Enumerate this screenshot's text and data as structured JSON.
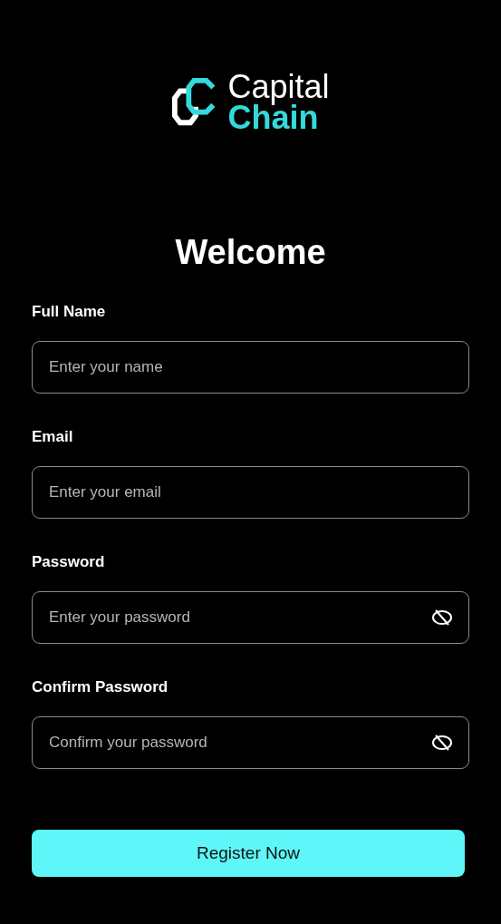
{
  "logo": {
    "line_1": "Capital",
    "line_2": "Chain"
  },
  "title": "Welcome",
  "fields": [
    {
      "label": "Full Name",
      "placeholder": "Enter your name",
      "kind": "text"
    },
    {
      "label": "Email",
      "placeholder": "Enter your email",
      "kind": "text"
    },
    {
      "label": "Password",
      "placeholder": "Enter your password",
      "kind": "password"
    },
    {
      "label": "Confirm Password",
      "placeholder": "Confirm your password",
      "kind": "password"
    }
  ],
  "submit": "Register Now"
}
